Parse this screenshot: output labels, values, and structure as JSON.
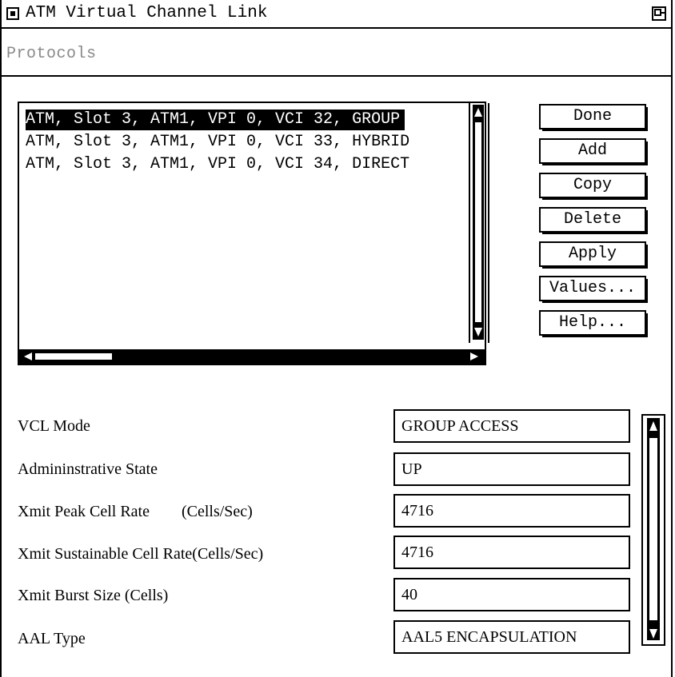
{
  "window": {
    "title": "ATM Virtual Channel Link",
    "menu": {
      "protocols_label": "Protocols"
    }
  },
  "vc_list": {
    "items": [
      "ATM, Slot 3, ATM1, VPI 0, VCI 32, GROUP",
      "ATM, Slot 3, ATM1, VPI 0, VCI 33, HYBRID",
      "ATM, Slot 3, ATM1, VPI 0, VCI 34, DIRECT"
    ],
    "selected_index": 0
  },
  "buttons": {
    "done": "Done",
    "add": "Add",
    "copy": "Copy",
    "delete": "Delete",
    "apply": "Apply",
    "values": "Values...",
    "help": "Help..."
  },
  "fields": [
    {
      "label": "VCL Mode",
      "value": "GROUP ACCESS"
    },
    {
      "label": "Admininstrative State",
      "value": "UP"
    },
    {
      "label": "Xmit Peak Cell Rate        (Cells/Sec)",
      "value": "4716"
    },
    {
      "label": "Xmit Sustainable Cell Rate(Cells/Sec)",
      "value": "4716"
    },
    {
      "label": "Xmit Burst Size (Cells)",
      "value": "40"
    },
    {
      "label": "AAL Type",
      "value": "AAL5 ENCAPSULATION"
    }
  ],
  "colors": {
    "foreground": "#000000",
    "background": "#ffffff",
    "disabled_text": "#8a8a8a"
  },
  "icons": {
    "window_menu": "window-menu-icon",
    "restore": "restore-icon"
  }
}
